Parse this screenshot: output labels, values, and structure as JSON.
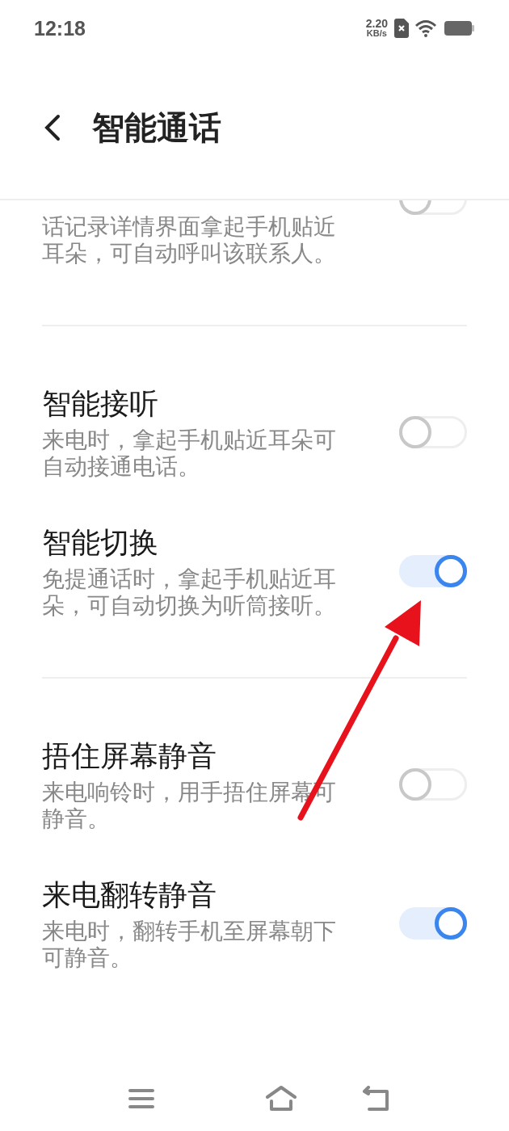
{
  "status_bar": {
    "time": "12:18",
    "net_speed": "2.20",
    "net_unit": "KB/s"
  },
  "header": {
    "title": "智能通话"
  },
  "groups": [
    {
      "items": [
        {
          "kind": "partial",
          "description": "话记录详情界面拿起手机贴近耳朵，可自动呼叫该联系人。",
          "on": false
        }
      ]
    },
    {
      "items": [
        {
          "kind": "full",
          "title": "智能接听",
          "description": "来电时，拿起手机贴近耳朵可自动接通电话。",
          "on": false
        },
        {
          "kind": "full",
          "title": "智能切换",
          "description": "免提通话时，拿起手机贴近耳朵，可自动切换为听筒接听。",
          "on": true
        }
      ]
    },
    {
      "items": [
        {
          "kind": "full",
          "title": "捂住屏幕静音",
          "description": "来电响铃时，用手捂住屏幕可静音。",
          "on": false
        },
        {
          "kind": "full",
          "title": "来电翻转静音",
          "description": "来电时，翻转手机至屏幕朝下可静音。",
          "on": true
        }
      ]
    }
  ]
}
